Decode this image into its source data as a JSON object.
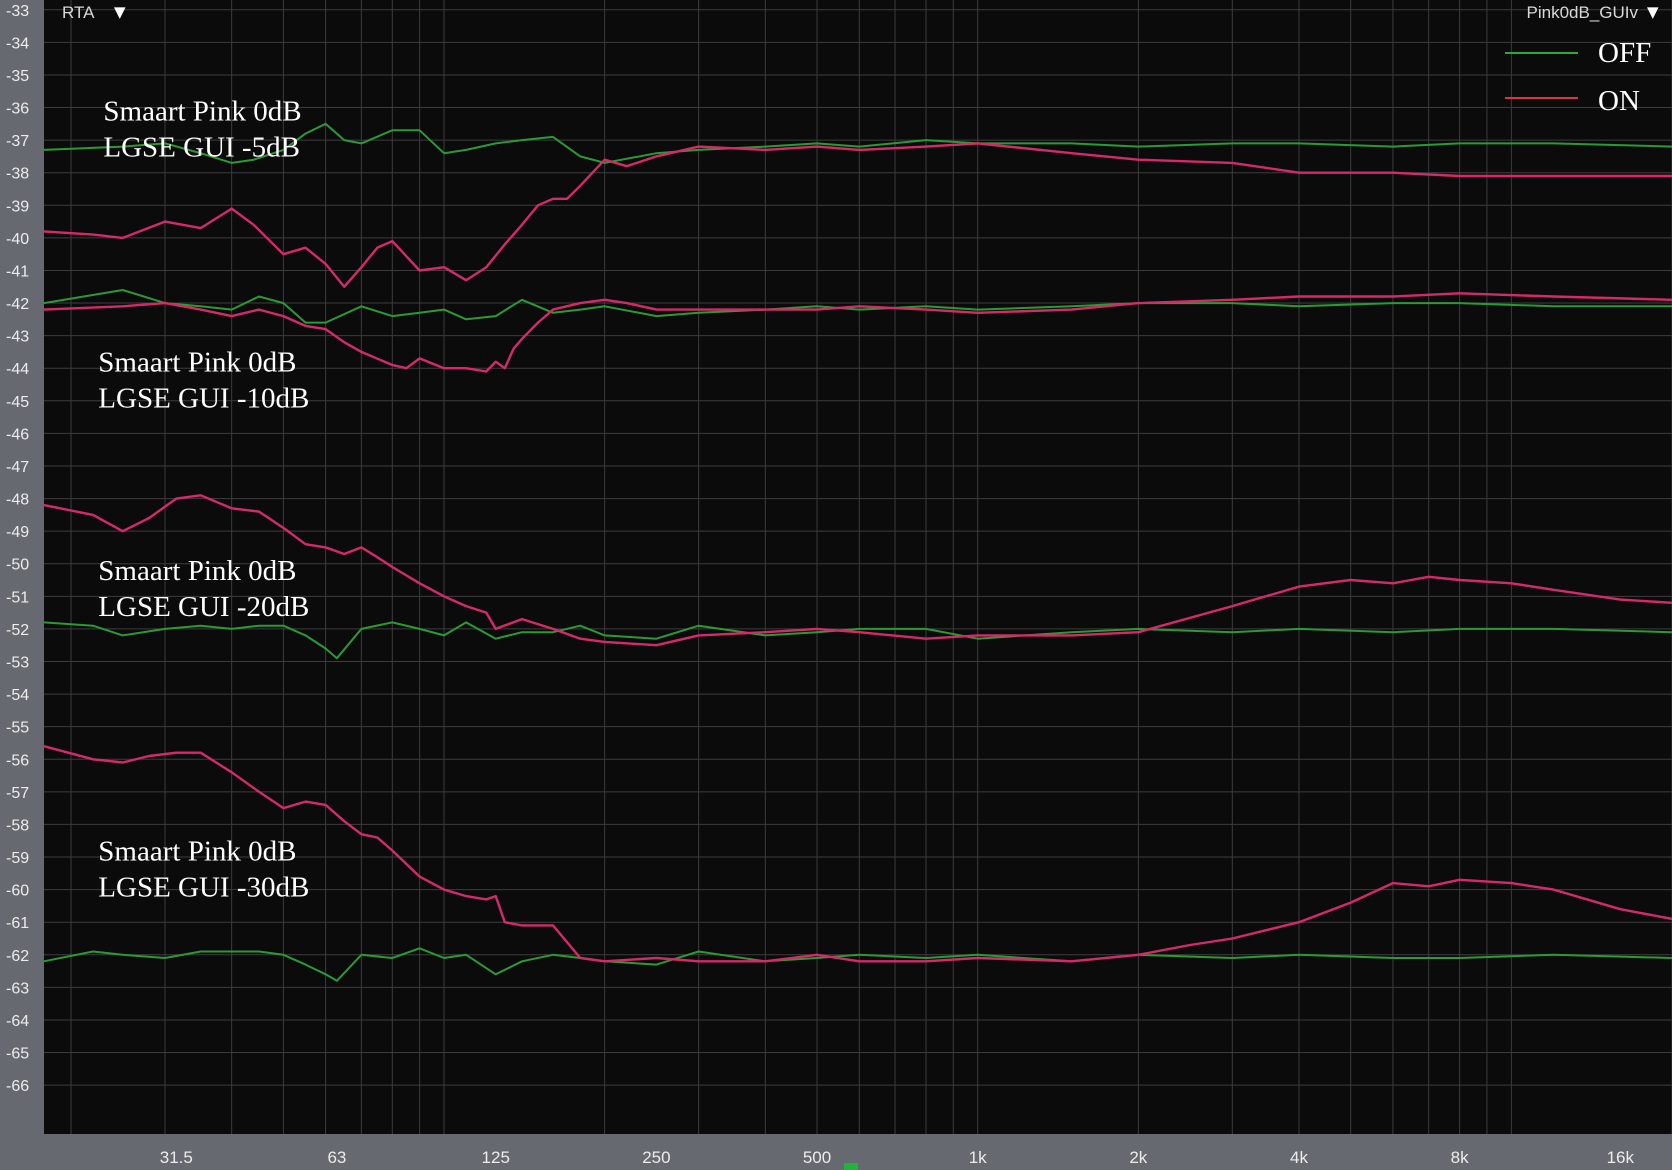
{
  "header": {
    "left_menu": "RTA",
    "right_menu": "Pink0dB_GUIv",
    "dropdown_glyph": "▼"
  },
  "colors": {
    "background": "#0b0b0b",
    "grid": "#3c3c3c",
    "axis_panel": "#666a70",
    "off": "#2a9a35",
    "on": "#d52a6a",
    "text": "#ffffff"
  },
  "legend": [
    {
      "label": "OFF",
      "color": "#2aa83a"
    },
    {
      "label": "ON",
      "color": "#e0304a"
    }
  ],
  "annotations": [
    {
      "line1": "Smaart Pink 0dB",
      "line2": "LGSE GUI -5dB",
      "anchor_freq": 23,
      "anchor_db": -36.4
    },
    {
      "line1": "Smaart Pink 0dB",
      "line2": "LGSE GUI -10dB",
      "anchor_freq": 22.5,
      "anchor_db": -44.1
    },
    {
      "line1": "Smaart Pink 0dB",
      "line2": "LGSE GUI -20dB",
      "anchor_freq": 22.5,
      "anchor_db": -50.5
    },
    {
      "line1": "Smaart Pink 0dB",
      "line2": "LGSE GUI -30dB",
      "anchor_freq": 22.5,
      "anchor_db": -59.1
    }
  ],
  "chart_data": {
    "type": "line",
    "xscale": "log",
    "xlim": [
      17.8,
      20000
    ],
    "ylim": [
      -67.5,
      -32.7
    ],
    "xticks": [
      {
        "value": 31.5,
        "label": "31.5"
      },
      {
        "value": 63,
        "label": "63"
      },
      {
        "value": 125,
        "label": "125"
      },
      {
        "value": 250,
        "label": "250"
      },
      {
        "value": 500,
        "label": "500"
      },
      {
        "value": 1000,
        "label": "1k"
      },
      {
        "value": 2000,
        "label": "2k"
      },
      {
        "value": 4000,
        "label": "4k"
      },
      {
        "value": 8000,
        "label": "8k"
      },
      {
        "value": 16000,
        "label": "16k"
      }
    ],
    "yticks": [
      "-33",
      "-34",
      "-35",
      "-36",
      "-37",
      "-38",
      "-39",
      "-40",
      "-41",
      "-42",
      "-43",
      "-44",
      "-45",
      "-46",
      "-47",
      "-48",
      "-49",
      "-50",
      "-51",
      "-52",
      "-53",
      "-54",
      "-55",
      "-56",
      "-57",
      "-58",
      "-59",
      "-60",
      "-61",
      "-62",
      "-63",
      "-64",
      "-65",
      "-66"
    ],
    "grid": true,
    "legend_position": "top-right",
    "series": [
      {
        "name": "OFF",
        "group": "-5dB",
        "color": "off",
        "x": [
          17.8,
          25,
          30,
          35,
          40,
          44,
          50,
          55,
          60,
          65,
          70,
          80,
          90,
          100,
          110,
          125,
          140,
          160,
          180,
          200,
          250,
          300,
          400,
          500,
          600,
          800,
          1000,
          1500,
          2000,
          3000,
          4000,
          6000,
          8000,
          12000,
          20000
        ],
        "y": [
          -37.3,
          -37.2,
          -37.1,
          -37.4,
          -37.7,
          -37.6,
          -37.3,
          -36.8,
          -36.5,
          -37.0,
          -37.1,
          -36.7,
          -36.7,
          -37.4,
          -37.3,
          -37.1,
          -37.0,
          -36.9,
          -37.5,
          -37.7,
          -37.4,
          -37.3,
          -37.2,
          -37.1,
          -37.2,
          -37.0,
          -37.1,
          -37.1,
          -37.2,
          -37.1,
          -37.1,
          -37.2,
          -37.1,
          -37.1,
          -37.2
        ]
      },
      {
        "name": "ON",
        "group": "-5dB",
        "color": "on",
        "x": [
          17.8,
          22,
          25,
          30,
          35,
          40,
          44,
          50,
          55,
          60,
          65,
          70,
          75,
          80,
          90,
          100,
          110,
          120,
          130,
          140,
          150,
          160,
          170,
          180,
          200,
          220,
          250,
          300,
          400,
          500,
          600,
          800,
          1000,
          1500,
          2000,
          3000,
          4000,
          6000,
          8000,
          12000,
          20000
        ],
        "y": [
          -39.8,
          -39.9,
          -40.0,
          -39.5,
          -39.7,
          -39.1,
          -39.6,
          -40.5,
          -40.3,
          -40.8,
          -41.5,
          -40.9,
          -40.3,
          -40.1,
          -41.0,
          -40.9,
          -41.3,
          -40.9,
          -40.2,
          -39.6,
          -39.0,
          -38.8,
          -38.8,
          -38.4,
          -37.6,
          -37.8,
          -37.5,
          -37.2,
          -37.3,
          -37.2,
          -37.3,
          -37.2,
          -37.1,
          -37.4,
          -37.6,
          -37.7,
          -38.0,
          -38.0,
          -38.1,
          -38.1,
          -38.1
        ]
      },
      {
        "name": "OFF",
        "group": "-10dB",
        "color": "off",
        "x": [
          17.8,
          25,
          30,
          35,
          40,
          45,
          50,
          55,
          60,
          70,
          80,
          90,
          100,
          110,
          125,
          140,
          160,
          180,
          200,
          250,
          300,
          400,
          500,
          600,
          800,
          1000,
          1500,
          2000,
          3000,
          4000,
          6000,
          8000,
          12000,
          20000
        ],
        "y": [
          -42.0,
          -41.6,
          -42.0,
          -42.1,
          -42.2,
          -41.8,
          -42.0,
          -42.6,
          -42.6,
          -42.1,
          -42.4,
          -42.3,
          -42.2,
          -42.5,
          -42.4,
          -41.9,
          -42.3,
          -42.2,
          -42.1,
          -42.4,
          -42.3,
          -42.2,
          -42.1,
          -42.2,
          -42.1,
          -42.2,
          -42.1,
          -42.0,
          -42.0,
          -42.1,
          -42.0,
          -42.0,
          -42.1,
          -42.1
        ]
      },
      {
        "name": "ON",
        "group": "-10dB",
        "color": "on",
        "x": [
          17.8,
          25,
          30,
          35,
          40,
          45,
          50,
          55,
          60,
          65,
          70,
          80,
          85,
          90,
          100,
          110,
          120,
          125,
          130,
          135,
          140,
          150,
          160,
          180,
          200,
          220,
          250,
          300,
          400,
          500,
          600,
          800,
          1000,
          1500,
          2000,
          3000,
          4000,
          6000,
          8000,
          12000,
          20000
        ],
        "y": [
          -42.2,
          -42.1,
          -42.0,
          -42.2,
          -42.4,
          -42.2,
          -42.4,
          -42.7,
          -42.8,
          -43.2,
          -43.5,
          -43.9,
          -44.0,
          -43.7,
          -44.0,
          -44.0,
          -44.1,
          -43.8,
          -44.0,
          -43.4,
          -43.1,
          -42.6,
          -42.2,
          -42.0,
          -41.9,
          -42.0,
          -42.2,
          -42.2,
          -42.2,
          -42.2,
          -42.1,
          -42.2,
          -42.3,
          -42.2,
          -42.0,
          -41.9,
          -41.8,
          -41.8,
          -41.7,
          -41.8,
          -41.9
        ]
      },
      {
        "name": "OFF",
        "group": "-20dB",
        "color": "off",
        "x": [
          17.8,
          22,
          25,
          30,
          35,
          40,
          45,
          50,
          55,
          60,
          63,
          70,
          80,
          90,
          100,
          110,
          125,
          140,
          160,
          180,
          200,
          250,
          300,
          400,
          500,
          600,
          800,
          1000,
          1500,
          2000,
          3000,
          4000,
          6000,
          8000,
          12000,
          20000
        ],
        "y": [
          -51.8,
          -51.9,
          -52.2,
          -52.0,
          -51.9,
          -52.0,
          -51.9,
          -51.9,
          -52.2,
          -52.6,
          -52.9,
          -52.0,
          -51.8,
          -52.0,
          -52.2,
          -51.8,
          -52.3,
          -52.1,
          -52.1,
          -51.9,
          -52.2,
          -52.3,
          -51.9,
          -52.2,
          -52.1,
          -52.0,
          -52.0,
          -52.3,
          -52.1,
          -52.0,
          -52.1,
          -52.0,
          -52.1,
          -52.0,
          -52.0,
          -52.1
        ]
      },
      {
        "name": "ON",
        "group": "-20dB",
        "color": "on",
        "x": [
          17.8,
          22,
          25,
          28,
          31.5,
          35,
          40,
          45,
          50,
          55,
          60,
          65,
          70,
          75,
          80,
          90,
          100,
          110,
          120,
          125,
          140,
          160,
          180,
          200,
          250,
          300,
          400,
          500,
          600,
          800,
          1000,
          1500,
          2000,
          3000,
          4000,
          5000,
          6000,
          7000,
          8000,
          10000,
          12000,
          16000,
          20000
        ],
        "y": [
          -48.2,
          -48.5,
          -49.0,
          -48.6,
          -48.0,
          -47.9,
          -48.3,
          -48.4,
          -48.9,
          -49.4,
          -49.5,
          -49.7,
          -49.5,
          -49.8,
          -50.1,
          -50.6,
          -51.0,
          -51.3,
          -51.5,
          -52.0,
          -51.7,
          -52.0,
          -52.3,
          -52.4,
          -52.5,
          -52.2,
          -52.1,
          -52.0,
          -52.1,
          -52.3,
          -52.2,
          -52.2,
          -52.1,
          -51.3,
          -50.7,
          -50.5,
          -50.6,
          -50.4,
          -50.5,
          -50.6,
          -50.8,
          -51.1,
          -51.2
        ]
      },
      {
        "name": "OFF",
        "group": "-30dB",
        "color": "off",
        "x": [
          17.8,
          22,
          25,
          30,
          35,
          40,
          45,
          50,
          55,
          60,
          63,
          70,
          80,
          90,
          100,
          110,
          125,
          140,
          160,
          180,
          200,
          250,
          300,
          400,
          500,
          600,
          800,
          1000,
          1500,
          2000,
          3000,
          4000,
          6000,
          8000,
          12000,
          20000
        ],
        "y": [
          -62.2,
          -61.9,
          -62.0,
          -62.1,
          -61.9,
          -61.9,
          -61.9,
          -62.0,
          -62.3,
          -62.6,
          -62.8,
          -62.0,
          -62.1,
          -61.8,
          -62.1,
          -62.0,
          -62.6,
          -62.2,
          -62.0,
          -62.1,
          -62.2,
          -62.3,
          -61.9,
          -62.2,
          -62.1,
          -62.0,
          -62.1,
          -62.0,
          -62.2,
          -62.0,
          -62.1,
          -62.0,
          -62.1,
          -62.1,
          -62.0,
          -62.1
        ]
      },
      {
        "name": "ON",
        "group": "-30dB",
        "color": "on",
        "x": [
          17.8,
          22,
          25,
          28,
          31.5,
          35,
          40,
          45,
          50,
          55,
          60,
          65,
          70,
          75,
          80,
          90,
          100,
          110,
          120,
          125,
          130,
          140,
          160,
          180,
          200,
          250,
          300,
          400,
          500,
          600,
          800,
          1000,
          1500,
          2000,
          2500,
          3000,
          4000,
          5000,
          6000,
          7000,
          8000,
          10000,
          12000,
          16000,
          20000
        ],
        "y": [
          -55.6,
          -56.0,
          -56.1,
          -55.9,
          -55.8,
          -55.8,
          -56.4,
          -57.0,
          -57.5,
          -57.3,
          -57.4,
          -57.9,
          -58.3,
          -58.4,
          -58.8,
          -59.6,
          -60.0,
          -60.2,
          -60.3,
          -60.2,
          -61.0,
          -61.1,
          -61.1,
          -62.1,
          -62.2,
          -62.1,
          -62.2,
          -62.2,
          -62.0,
          -62.2,
          -62.2,
          -62.1,
          -62.2,
          -62.0,
          -61.7,
          -61.5,
          -61.0,
          -60.4,
          -59.8,
          -59.9,
          -59.7,
          -59.8,
          -60.0,
          -60.6,
          -60.9
        ]
      }
    ]
  }
}
